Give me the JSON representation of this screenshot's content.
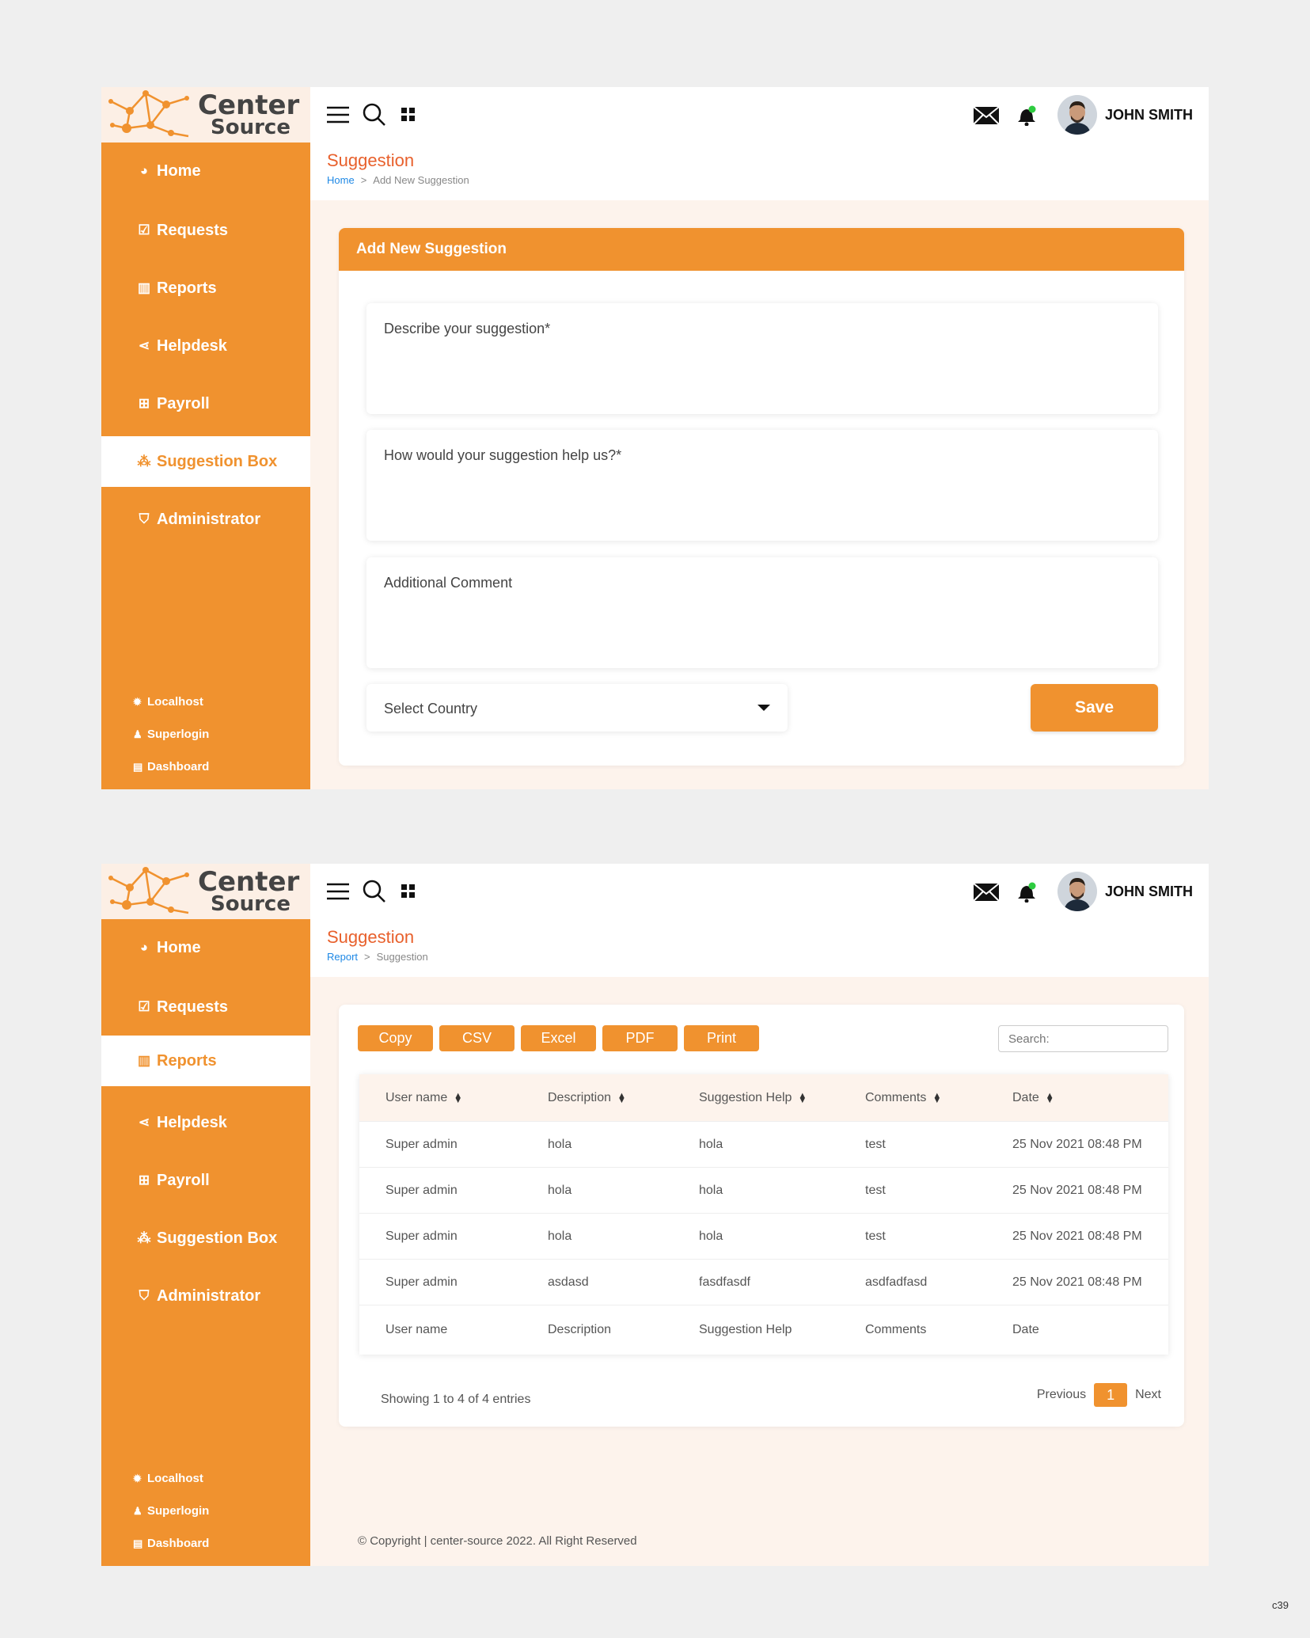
{
  "brand": {
    "line1": "Center",
    "line2": "Source"
  },
  "topbar": {
    "user_name": "JOHN SMITH"
  },
  "colors": {
    "accent": "#f0922f",
    "title": "#e8602c",
    "link": "#1e88e5",
    "panel_bg": "#fdf3ec"
  },
  "sidebar_footer": {
    "localhost": "Localhost",
    "superlogin": "Superlogin",
    "dashboard": "Dashboard"
  },
  "form_screen": {
    "sidebar": [
      {
        "icon": "palette-icon",
        "label": "Home",
        "active": false
      },
      {
        "icon": "check-square-icon",
        "label": "Requests",
        "active": false
      },
      {
        "icon": "bar-chart-icon",
        "label": "Reports",
        "active": false
      },
      {
        "icon": "share-icon",
        "label": "Helpdesk",
        "active": false
      },
      {
        "icon": "plus-square-icon",
        "label": "Payroll",
        "active": false
      },
      {
        "icon": "spinner-icon",
        "label": "Suggestion Box",
        "active": true
      },
      {
        "icon": "shield-icon",
        "label": "Administrator",
        "active": false
      }
    ],
    "title": "Suggestion",
    "breadcrumb": {
      "home": "Home",
      "separator": ">",
      "current": "Add New Suggestion"
    },
    "card_title": "Add New Suggestion",
    "fields": {
      "describe": "Describe your suggestion*",
      "help": "How would your suggestion help us?*",
      "comment": "Additional Comment",
      "country": "Select Country"
    },
    "save_label": "Save"
  },
  "table_screen": {
    "sidebar": [
      {
        "icon": "palette-icon",
        "label": "Home",
        "active": false
      },
      {
        "icon": "check-square-icon",
        "label": "Requests",
        "active": false
      },
      {
        "icon": "bar-chart-icon",
        "label": "Reports",
        "active": true
      },
      {
        "icon": "share-icon",
        "label": "Helpdesk",
        "active": false
      },
      {
        "icon": "plus-square-icon",
        "label": "Payroll",
        "active": false
      },
      {
        "icon": "spinner-icon",
        "label": "Suggestion Box",
        "active": false
      },
      {
        "icon": "shield-icon",
        "label": "Administrator",
        "active": false
      }
    ],
    "title": "Suggestion",
    "breadcrumb": {
      "home": "Report",
      "separator": ">",
      "current": "Suggestion"
    },
    "export_buttons": [
      "Copy",
      "CSV",
      "Excel",
      "PDF",
      "Print"
    ],
    "search_placeholder": "Search:",
    "columns": [
      "User name",
      "Description",
      "Suggestion Help",
      "Comments",
      "Date"
    ],
    "rows": [
      [
        "Super admin",
        "hola",
        "hola",
        "test",
        "25 Nov 2021 08:48 PM"
      ],
      [
        "Super admin",
        "hola",
        "hola",
        "test",
        "25 Nov 2021 08:48 PM"
      ],
      [
        "Super admin",
        "hola",
        "hola",
        "test",
        "25 Nov 2021 08:48 PM"
      ],
      [
        "Super admin",
        "asdasd",
        "fasdfasdf",
        "asdfadfasd",
        "25 Nov 2021 08:48 PM"
      ]
    ],
    "footer_columns": [
      "User name",
      "Description",
      "Suggestion Help",
      "Comments",
      "Date"
    ],
    "showing": "Showing 1 to 4 of 4 entries",
    "pagination": {
      "previous": "Previous",
      "current": "1",
      "next": "Next"
    },
    "copyright": "© Copyright | center-source 2022. All Right Reserved"
  },
  "corner_code": "c39"
}
